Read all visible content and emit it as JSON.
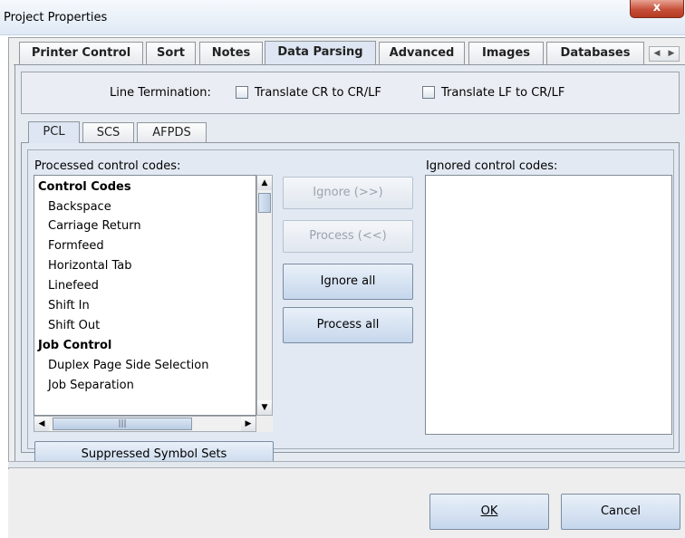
{
  "window": {
    "title": "Project Properties",
    "close_glyph": "x"
  },
  "tabs": [
    {
      "label": "Printer Control"
    },
    {
      "label": "Sort"
    },
    {
      "label": "Notes"
    },
    {
      "label": "Data Parsing",
      "active": true
    },
    {
      "label": "Advanced"
    },
    {
      "label": "Images"
    },
    {
      "label": "Databases"
    }
  ],
  "tab_scroll": {
    "left": "◀",
    "right": "▶"
  },
  "line_termination": {
    "label": "Line Termination:",
    "options": [
      {
        "label": "Translate CR to CR/LF",
        "checked": false
      },
      {
        "label": "Translate LF to CR/LF",
        "checked": false
      }
    ]
  },
  "sub_tabs": [
    {
      "label": "PCL",
      "active": true
    },
    {
      "label": "SCS"
    },
    {
      "label": "AFPDS"
    }
  ],
  "processed": {
    "label": "Processed control codes:",
    "items": [
      {
        "text": "Control Codes",
        "header": true
      },
      {
        "text": "Backspace"
      },
      {
        "text": "Carriage Return"
      },
      {
        "text": "Formfeed"
      },
      {
        "text": "Horizontal Tab"
      },
      {
        "text": "Linefeed"
      },
      {
        "text": "Shift In"
      },
      {
        "text": "Shift Out"
      },
      {
        "text": "Job Control",
        "header": true
      },
      {
        "text": "Duplex Page Side Selection"
      },
      {
        "text": "Job Separation"
      }
    ]
  },
  "ignored": {
    "label": "Ignored control codes:",
    "items": []
  },
  "actions": {
    "ignore": "Ignore (>>)",
    "process": "Process (<<)",
    "ignore_all": "Ignore all",
    "process_all": "Process all"
  },
  "suppressed_button": "Suppressed Symbol Sets",
  "scroll_glyphs": {
    "up": "▲",
    "down": "▼",
    "left": "◀",
    "right": "▶",
    "grip": "|||"
  },
  "footer": {
    "ok": "OK",
    "cancel": "Cancel"
  },
  "colors": {
    "accent": "#c6d7ec",
    "close": "#c7503a"
  }
}
